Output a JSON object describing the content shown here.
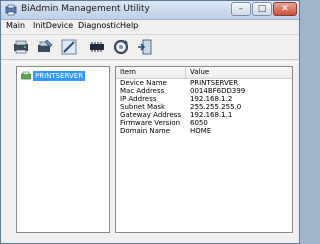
{
  "window": {
    "title": "BiAdmin Management Utility"
  },
  "menu": [
    {
      "label": "Main"
    },
    {
      "label": "InitDevice"
    },
    {
      "label": "Diagnostic"
    },
    {
      "label": "Help"
    }
  ],
  "toolbar": [
    {
      "icon": "printer-device-icon"
    },
    {
      "icon": "configure-icon"
    },
    {
      "icon": "edit-icon"
    },
    {
      "icon": "memory-chip-icon"
    },
    {
      "icon": "refresh-icon"
    },
    {
      "icon": "exit-icon"
    }
  ],
  "tree": {
    "selected": "PRINTSERVER"
  },
  "table": {
    "columns": [
      "Item",
      "Value"
    ],
    "rows": [
      {
        "item": "Device Name",
        "value": "PRINTSERVER"
      },
      {
        "item": "Mac Address",
        "value": "0014BF6DD399"
      },
      {
        "item": "IP Address",
        "value": "192.168.1.2"
      },
      {
        "item": "Subnet Mask",
        "value": "255.255.255.0"
      },
      {
        "item": "Gateway Address",
        "value": "192.168.1.1"
      },
      {
        "item": "Firmware Version",
        "value": "6050"
      },
      {
        "item": "Domain Name",
        "value": "HOME"
      }
    ]
  },
  "colors": {
    "selection": "#3399ff",
    "titlebar": "#bcd0e8"
  }
}
